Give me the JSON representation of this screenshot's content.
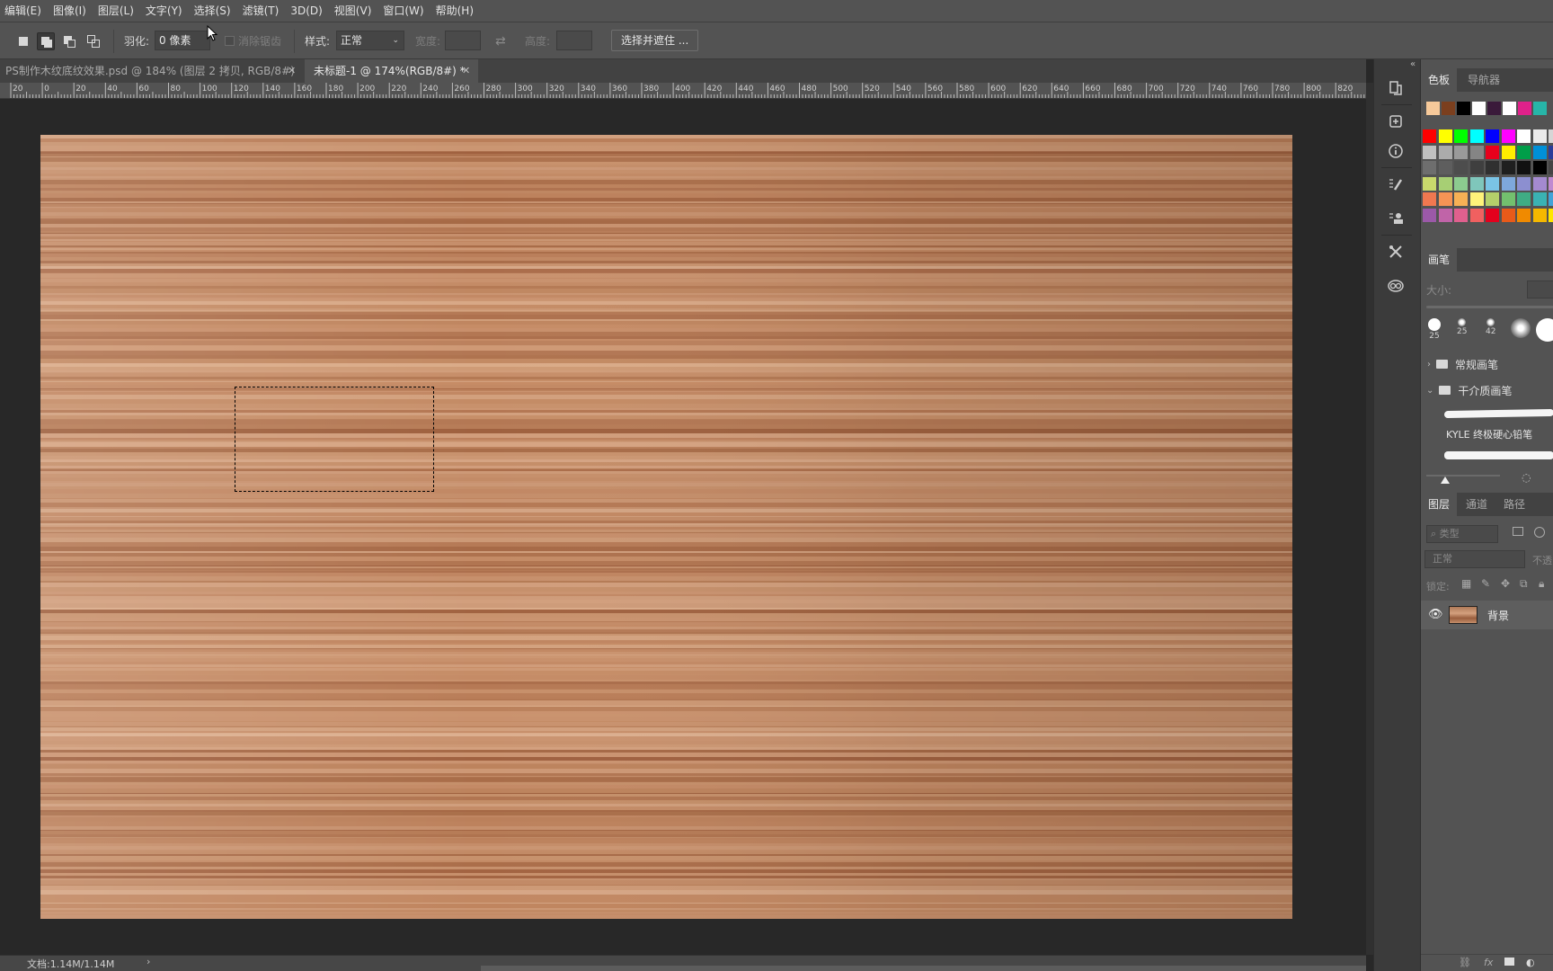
{
  "menu": [
    "编辑(E)",
    "图像(I)",
    "图层(L)",
    "文字(Y)",
    "选择(S)",
    "滤镜(T)",
    "3D(D)",
    "视图(V)",
    "窗口(W)",
    "帮助(H)"
  ],
  "options": {
    "feather_label": "羽化:",
    "feather_value": "0 像素",
    "antialias_label": "消除锯齿",
    "style_label": "样式:",
    "style_value": "正常",
    "width_label": "宽度:",
    "height_label": "高度:",
    "select_mask_button": "选择并遮住 ..."
  },
  "tabs": [
    {
      "title": "PS制作木纹底纹效果.psd @ 184% (图层 2 拷贝, RGB/8#)",
      "active": false
    },
    {
      "title": "未标题-1 @ 174%(RGB/8#) *",
      "active": true
    }
  ],
  "ruler": {
    "labels": [
      "20",
      "0",
      "20",
      "40",
      "60",
      "80",
      "100",
      "120",
      "140",
      "160",
      "180",
      "200",
      "220",
      "240",
      "260",
      "280",
      "300",
      "320",
      "340",
      "360",
      "380",
      "400",
      "420",
      "440",
      "460",
      "480",
      "500",
      "520",
      "540",
      "560",
      "580",
      "600",
      "620",
      "640",
      "660",
      "680",
      "700",
      "720",
      "740",
      "760",
      "780",
      "800",
      "820",
      "84"
    ]
  },
  "status": {
    "doc_info": "文档:1.14M/1.14M",
    "arrow": "›"
  },
  "right_strip_icons": [
    "history-icon",
    "adjustments-icon",
    "info-icon",
    "brush-settings-icon",
    "clone-source-icon",
    "tools-preset-icon",
    "libraries-icon"
  ],
  "swatches_panel": {
    "tabs": [
      "色板",
      "导航器"
    ],
    "recent": [
      "#f6c99a",
      "#7b3f1e",
      "#000000",
      "#ffffff",
      "#3a1a3a",
      "#ffffff",
      "#e0218a",
      "#27b5a8"
    ],
    "rows": [
      [
        "#ff0000",
        "#ffff00",
        "#00ff00",
        "#00ffff",
        "#0000ff",
        "#ff00ff",
        "#ffffff",
        "#ebebeb",
        "#d6d6d6"
      ],
      [
        "#c0c0c0",
        "#ababab",
        "#9a9a9a",
        "#858585",
        "#e8001c",
        "#ffee00",
        "#009e49",
        "#0090d8",
        "#2a3d99"
      ],
      [
        "#6e6e6e",
        "#5e5e5e",
        "#4d4d4d",
        "#3f3f3f",
        "#303030",
        "#1f1f1f",
        "#111111",
        "#000000",
        "#444444"
      ],
      [
        "#c9d96c",
        "#a7cf74",
        "#8ccb8f",
        "#7fc6bb",
        "#7ac4e6",
        "#7ea8dc",
        "#8c8fd0",
        "#a48ad0",
        "#c08ad0"
      ],
      [
        "#f07850",
        "#f59455",
        "#f7b155",
        "#fff27a",
        "#b5d06a",
        "#73c06e",
        "#3fac84",
        "#3ab2b3",
        "#40a3d8"
      ],
      [
        "#9b59a8",
        "#c064a8",
        "#e0608e",
        "#f06060",
        "#e3001d",
        "#e85a1a",
        "#f08a00",
        "#f5b800",
        "#ffe600"
      ]
    ]
  },
  "brushes_panel": {
    "tab": "画笔",
    "size_label": "大小:",
    "tips": [
      {
        "label": "25",
        "size": 14
      },
      {
        "label": "25",
        "size": 9
      },
      {
        "label": "42",
        "size": 9
      },
      {
        "label": "",
        "size": 22
      },
      {
        "label": "",
        "size": 26
      }
    ],
    "groups": [
      {
        "name": "常规画笔",
        "expanded": false
      },
      {
        "name": "干介质画笔",
        "expanded": true
      }
    ],
    "preset_name": "KYLE 终极硬心铅笔"
  },
  "layers_panel": {
    "tabs": [
      "图层",
      "通道",
      "路径"
    ],
    "filter_placeholder": "类型",
    "blend_mode": "正常",
    "opacity_label": "不透",
    "lock_label": "锁定:",
    "layers": [
      {
        "name": "背景",
        "visible": true
      }
    ],
    "footer_icons": [
      "link-icon",
      "fx-icon",
      "mask-icon",
      "adjustment-icon"
    ]
  },
  "colors": {
    "wood_base": "#c48a64",
    "wood_light": "#e3b898",
    "wood_dark": "#8a4a2a"
  }
}
